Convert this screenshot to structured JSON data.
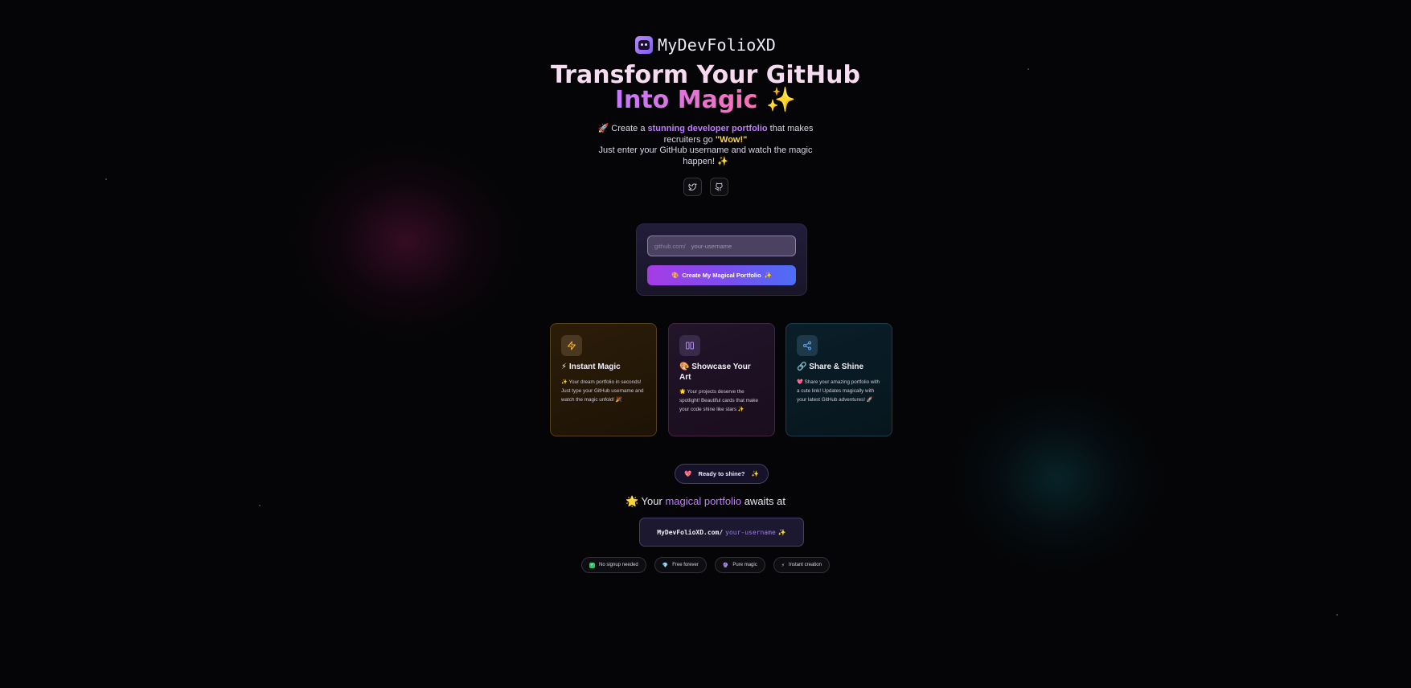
{
  "brand": {
    "name": "MyDevFolioXD",
    "logo_icon": "robot-face-icon"
  },
  "hero": {
    "title_line1": "Transform Your GitHub",
    "title_line2": "Into Magic",
    "title_emoji": "✨"
  },
  "subtitle": {
    "line1_emoji": "🚀",
    "line1_pre": "Create a ",
    "line1_accent": "stunning developer portfolio",
    "line1_post": " that makes",
    "line2_pre": "recruiters go ",
    "line2_wow": "\"Wow!\"",
    "line3": "Just enter your GitHub username and watch the magic",
    "line4": "happen! ✨"
  },
  "socials": [
    {
      "icon": "twitter-icon"
    },
    {
      "icon": "github-icon"
    }
  ],
  "form": {
    "prefix": "github.com/",
    "placeholder": "your-username",
    "button_emoji": "🎨",
    "button_label": "Create My Magical Portfolio",
    "button_sparkle": "✨"
  },
  "features": [
    {
      "icon": "lightning-icon",
      "title_emoji": "⚡",
      "title": "Instant Magic",
      "desc": "✨ Your dream portfolio in seconds! Just type your GitHub username and watch the magic unfold! 🎉"
    },
    {
      "icon": "columns-icon",
      "title_emoji": "🎨",
      "title": "Showcase Your Art",
      "desc": "🌟 Your projects deserve the spotlight! Beautiful cards that make your code shine like stars ✨"
    },
    {
      "icon": "share-icon",
      "title_emoji": "🔗",
      "title": "Share & Shine",
      "desc": "💖 Share your amazing portfolio with a cute link! Updates magically with your latest GitHub adventures! 🚀"
    }
  ],
  "ready": {
    "emoji": "💖",
    "label": "Ready to shine?",
    "sparkle": "✨"
  },
  "awaits": {
    "emoji": "🌟",
    "pre": "Your ",
    "accent": "magical portfolio",
    "post": " awaits at"
  },
  "url": {
    "host": "MyDevFolioXD.com/",
    "user": "your-username",
    "sparkle": "✨"
  },
  "badges": [
    {
      "emoji": "✓",
      "label": "No signup needed"
    },
    {
      "emoji": "💎",
      "label": "Free forever"
    },
    {
      "emoji": "🔮",
      "label": "Pure magic"
    },
    {
      "emoji": "⚡",
      "label": "Instant creation"
    }
  ],
  "colors": {
    "accent_purple": "#c07cff",
    "accent_pink": "#ff6fb2",
    "wow_yellow": "#ffd34a",
    "background": "#050507"
  }
}
